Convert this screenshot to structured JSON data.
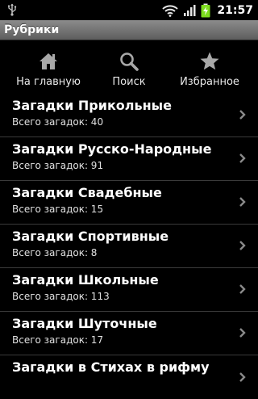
{
  "status_bar": {
    "usb_icon": "usb-icon",
    "wifi_icon": "wifi-icon",
    "signal_icon": "signal-icon",
    "battery_icon": "battery-charging-icon",
    "time": "21:57"
  },
  "title_bar": {
    "title": "Рубрики"
  },
  "nav": {
    "items": [
      {
        "label": "На главную",
        "icon": "home-icon"
      },
      {
        "label": "Поиск",
        "icon": "search-icon"
      },
      {
        "label": "Избранное",
        "icon": "star-icon"
      }
    ]
  },
  "list": {
    "items": [
      {
        "title": "Загадки Прикольные",
        "subtitle": "Всего загадок: 40"
      },
      {
        "title": "Загадки Русско-Народные",
        "subtitle": "Всего загадок: 91"
      },
      {
        "title": "Загадки Свадебные",
        "subtitle": "Всего загадок: 15"
      },
      {
        "title": "Загадки Спортивные",
        "subtitle": "Всего загадок: 8"
      },
      {
        "title": "Загадки Школьные",
        "subtitle": "Всего загадок: 113"
      },
      {
        "title": "Загадки Шуточные",
        "subtitle": "Всего загадок: 17"
      },
      {
        "title": "Загадки в Стихах в рифму",
        "subtitle": ""
      }
    ]
  },
  "colors": {
    "background": "#000000",
    "titlebar": "#7a7a7a",
    "battery_accent": "#7ddc1f",
    "divider": "#3a3a3a"
  }
}
